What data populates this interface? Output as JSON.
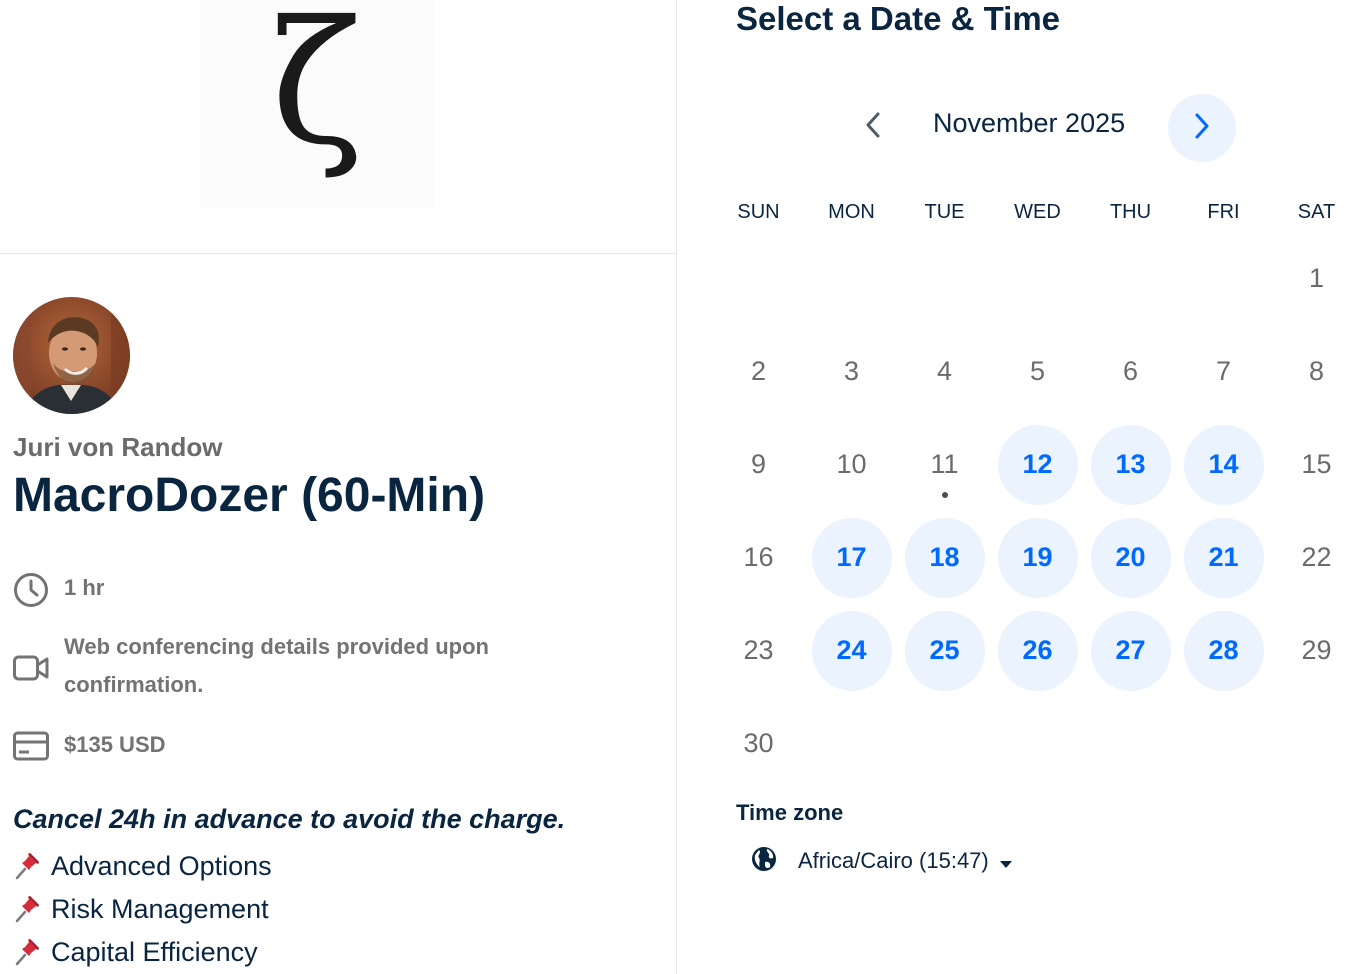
{
  "logo": {
    "glyph": "ζ"
  },
  "host": {
    "name": "Juri von Randow"
  },
  "event": {
    "title": "MacroDozer (60-Min)",
    "duration": "1 hr",
    "location": "Web conferencing details provided upon confirmation.",
    "price": "$135 USD",
    "cancel_note": "Cancel 24h in advance to avoid the charge.",
    "bullets": [
      "Advanced Options",
      "Risk Management",
      "Capital Efficiency"
    ]
  },
  "calendar": {
    "heading": "Select a Date & Time",
    "month": "November 2025",
    "weekdays": [
      "SUN",
      "MON",
      "TUE",
      "WED",
      "THU",
      "FRI",
      "SAT"
    ],
    "days": [
      "",
      "",
      "",
      "",
      "",
      "",
      "1",
      "2",
      "3",
      "4",
      "5",
      "6",
      "7",
      "8",
      "9",
      "10",
      "11",
      "12",
      "13",
      "14",
      "15",
      "16",
      "17",
      "18",
      "19",
      "20",
      "21",
      "22",
      "23",
      "24",
      "25",
      "26",
      "27",
      "28",
      "29",
      "30"
    ],
    "available_days": [
      "12",
      "13",
      "14",
      "17",
      "18",
      "19",
      "20",
      "21",
      "24",
      "25",
      "26",
      "27",
      "28"
    ],
    "today": "11"
  },
  "timezone": {
    "label": "Time zone",
    "value": "Africa/Cairo (15:47)"
  },
  "colors": {
    "accent": "#0069ff",
    "available_bg": "#ebf3fe",
    "heading": "#0a2540",
    "muted": "#737373"
  },
  "icons": {
    "duration": "clock-icon",
    "location": "video-camera-icon",
    "price": "credit-card-icon",
    "bullet": "pushpin-icon",
    "timezone": "globe-icon"
  }
}
